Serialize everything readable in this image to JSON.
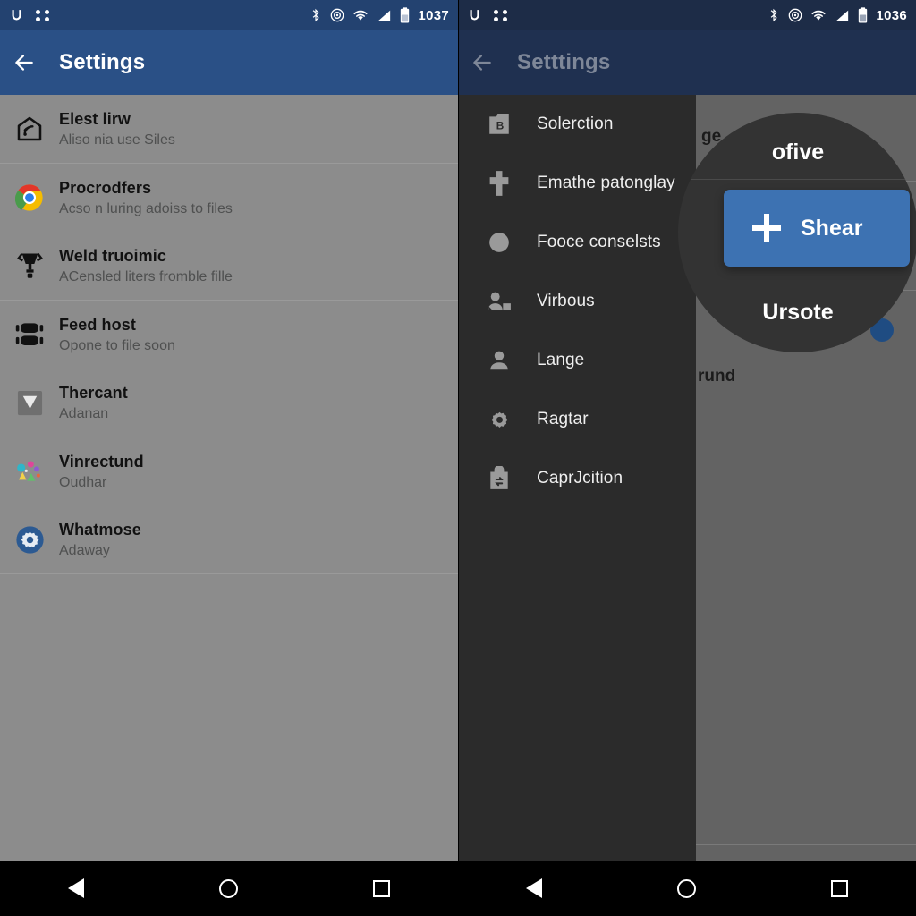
{
  "left": {
    "statusbar": {
      "icons_left": [
        "app-badge-icon",
        "four-dots-icon"
      ],
      "icons_right": [
        "bluetooth-icon",
        "location-icon",
        "wifi-icon",
        "signal-icon",
        "battery-icon"
      ],
      "time": "1037"
    },
    "appbar": {
      "back_icon": "back-arrow-icon",
      "title": "Settings",
      "color": "#2a5086"
    },
    "items": [
      {
        "icon": "home-wifi-icon",
        "title": "Elest lirw",
        "subtitle": "Aliso nia use Siles"
      },
      {
        "icon": "chrome-icon",
        "title": "Procrodfers",
        "subtitle": "Acso n luring adoiss to files"
      },
      {
        "icon": "trophy-icon",
        "title": "Weld truoimic",
        "subtitle": "ACensled liters fromble fille"
      },
      {
        "icon": "database-icon",
        "title": "Feed host",
        "subtitle": "Opone to file soon"
      },
      {
        "icon": "download-box-icon",
        "title": "Thercant",
        "subtitle": "Adanan"
      },
      {
        "icon": "confetti-icon",
        "title": "Vinrectund",
        "subtitle": "Oudhar"
      },
      {
        "icon": "blue-gear-icon",
        "title": "Whatmose",
        "subtitle": "Adaway"
      }
    ]
  },
  "right": {
    "statusbar": {
      "icons_left": [
        "app-badge-icon",
        "four-dots-icon"
      ],
      "icons_right": [
        "bluetooth-icon",
        "location-icon",
        "wifi-icon",
        "signal-icon",
        "battery-icon"
      ],
      "time": "1036"
    },
    "appbar": {
      "back_icon": "back-arrow-icon",
      "title": "Setttings",
      "color": "#1f3050"
    },
    "drawer": {
      "items": [
        {
          "icon": "b-badge-icon",
          "label": "Solerction"
        },
        {
          "icon": "plus-cross-icon",
          "label": "Emathe patonglay"
        },
        {
          "icon": "circle-icon",
          "label": "Fooce conselsts"
        },
        {
          "icon": "person-badge-icon",
          "label": "Virbous"
        },
        {
          "icon": "person-icon",
          "label": "Lange"
        },
        {
          "icon": "gear-icon",
          "label": "Ragtar"
        },
        {
          "icon": "refresh-bag-icon",
          "label": "CaprJcition"
        }
      ]
    },
    "background": {
      "fragment_top": "ge",
      "fragment_bottom": "rund",
      "accent_dot_color": "#1f4c82"
    },
    "magnifier": {
      "top_label": "ofive",
      "bottom_label": "Ursote",
      "button": {
        "icon": "plus-icon",
        "label": "Shear",
        "color": "#3d72b2"
      }
    }
  },
  "navbar": {
    "back_label": "back-triangle-icon",
    "home_label": "home-circle-icon",
    "recents_label": "recents-square-icon"
  }
}
